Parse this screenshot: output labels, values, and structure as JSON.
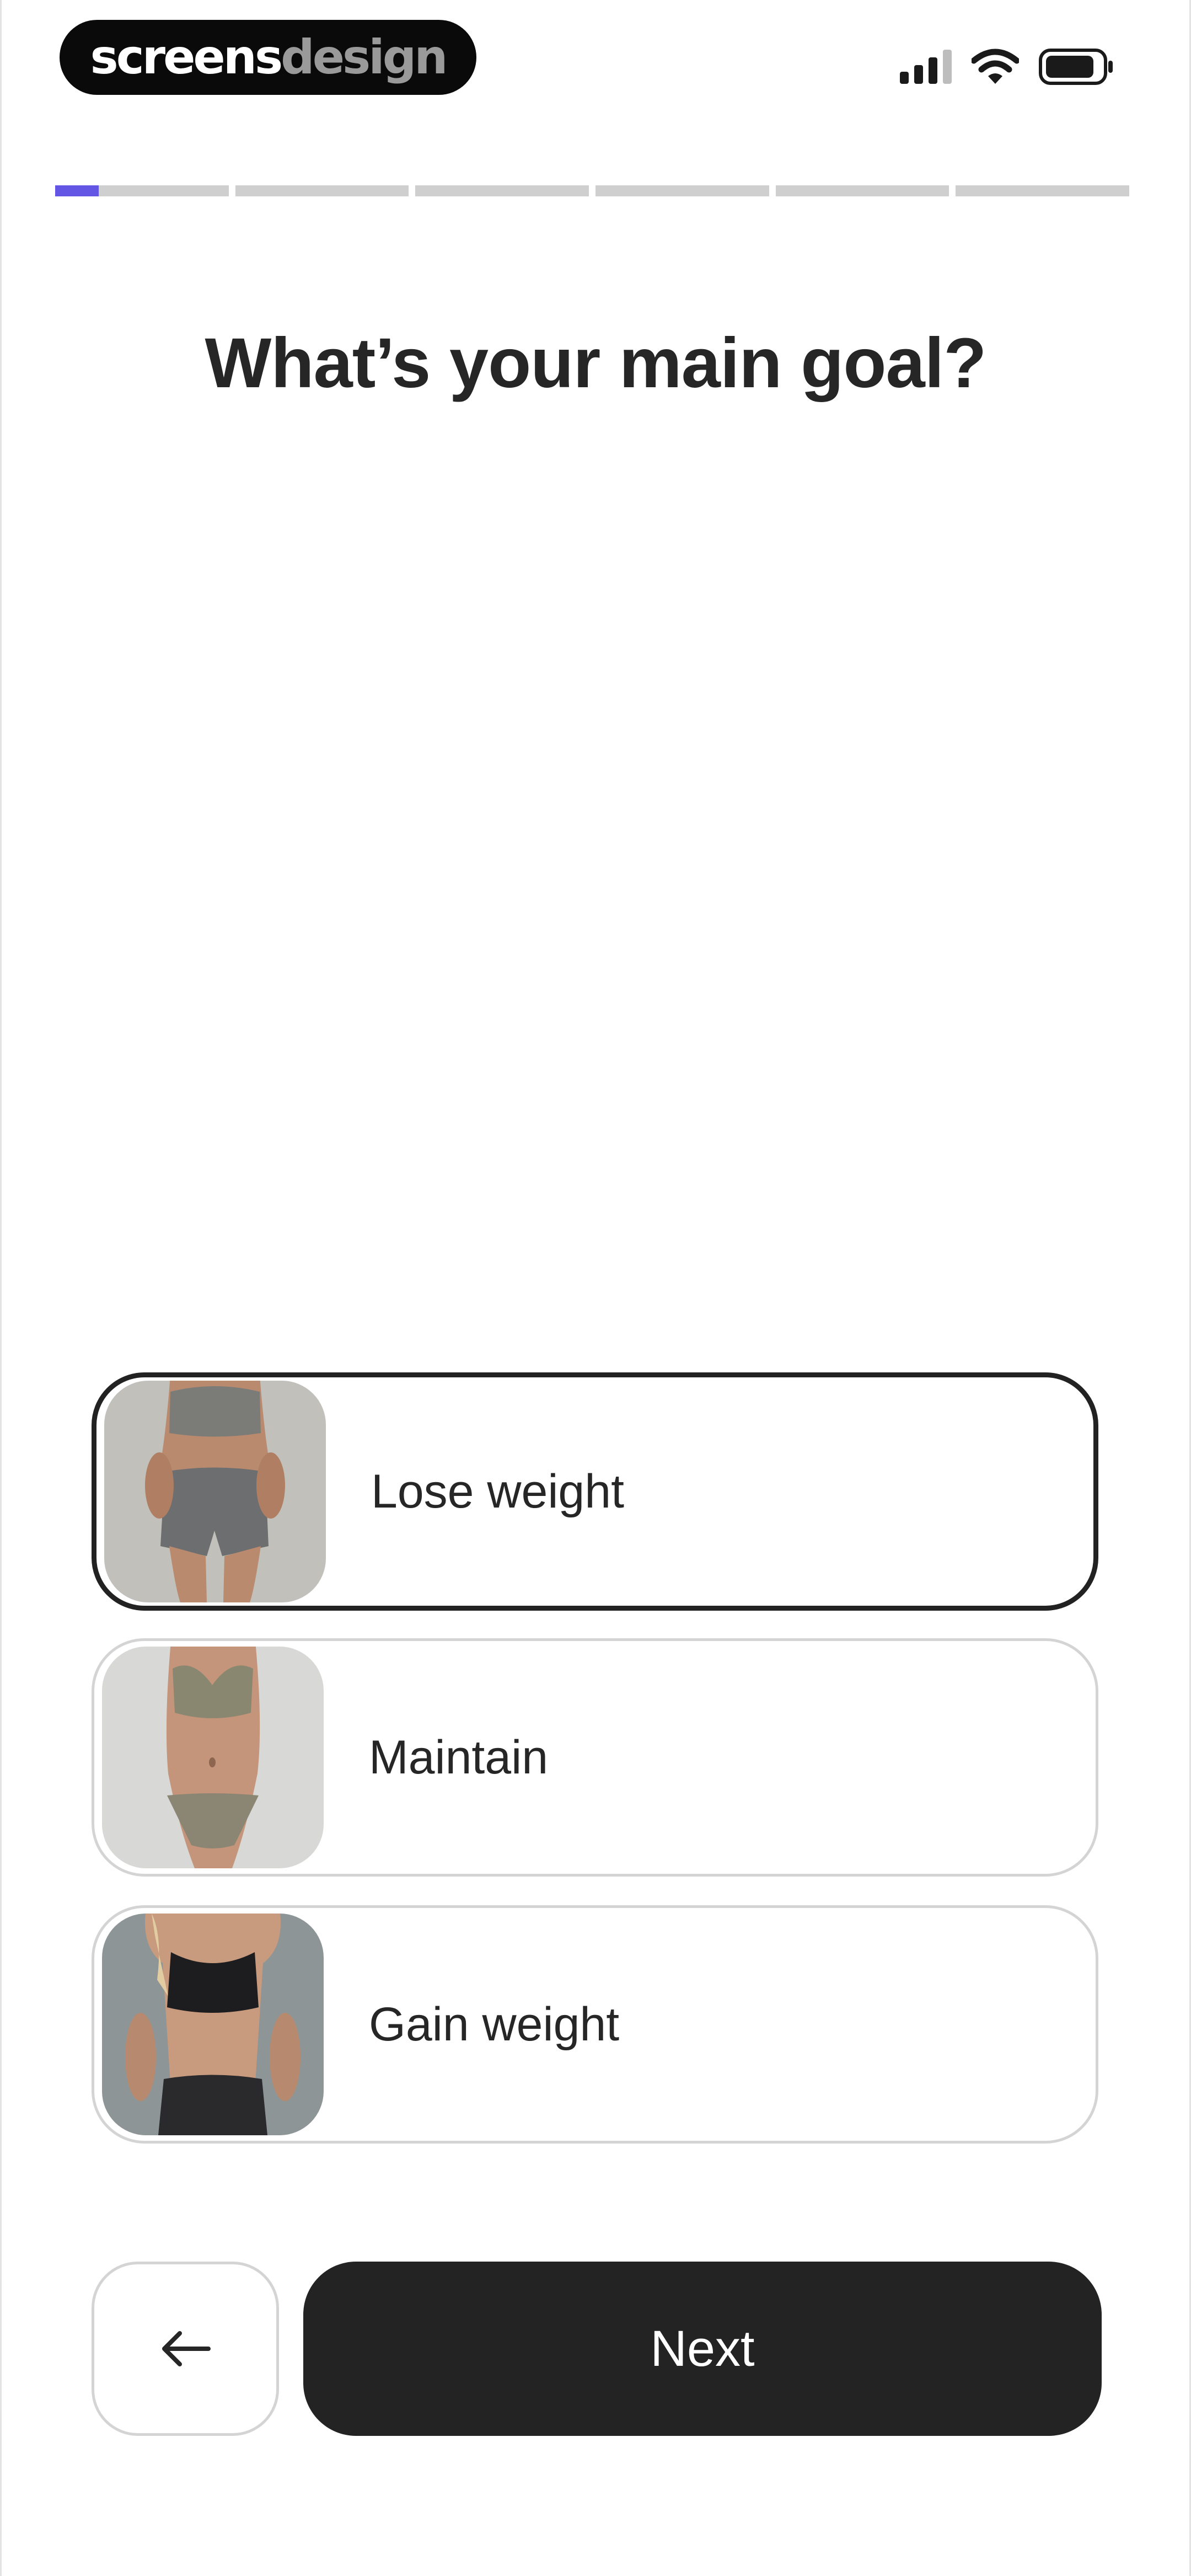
{
  "brand": {
    "part1": "screens",
    "part2": "design"
  },
  "status_bar": {
    "icons": [
      "cellular-signal-icon",
      "wifi-icon",
      "battery-icon"
    ]
  },
  "progress": {
    "total_steps": 6,
    "current_step": 1,
    "current_step_fraction": 0.25
  },
  "question": {
    "title": "What’s your main goal?"
  },
  "options": [
    {
      "label": "Lose weight",
      "selected": true
    },
    {
      "label": "Maintain",
      "selected": false
    },
    {
      "label": "Gain weight",
      "selected": false
    }
  ],
  "footer": {
    "back_icon": "arrow-left-icon",
    "next_label": "Next"
  },
  "colors": {
    "accent": "#6356e5",
    "primary_button": "#232323",
    "option_border": "#d4d4d4",
    "selected_border": "#222222"
  }
}
